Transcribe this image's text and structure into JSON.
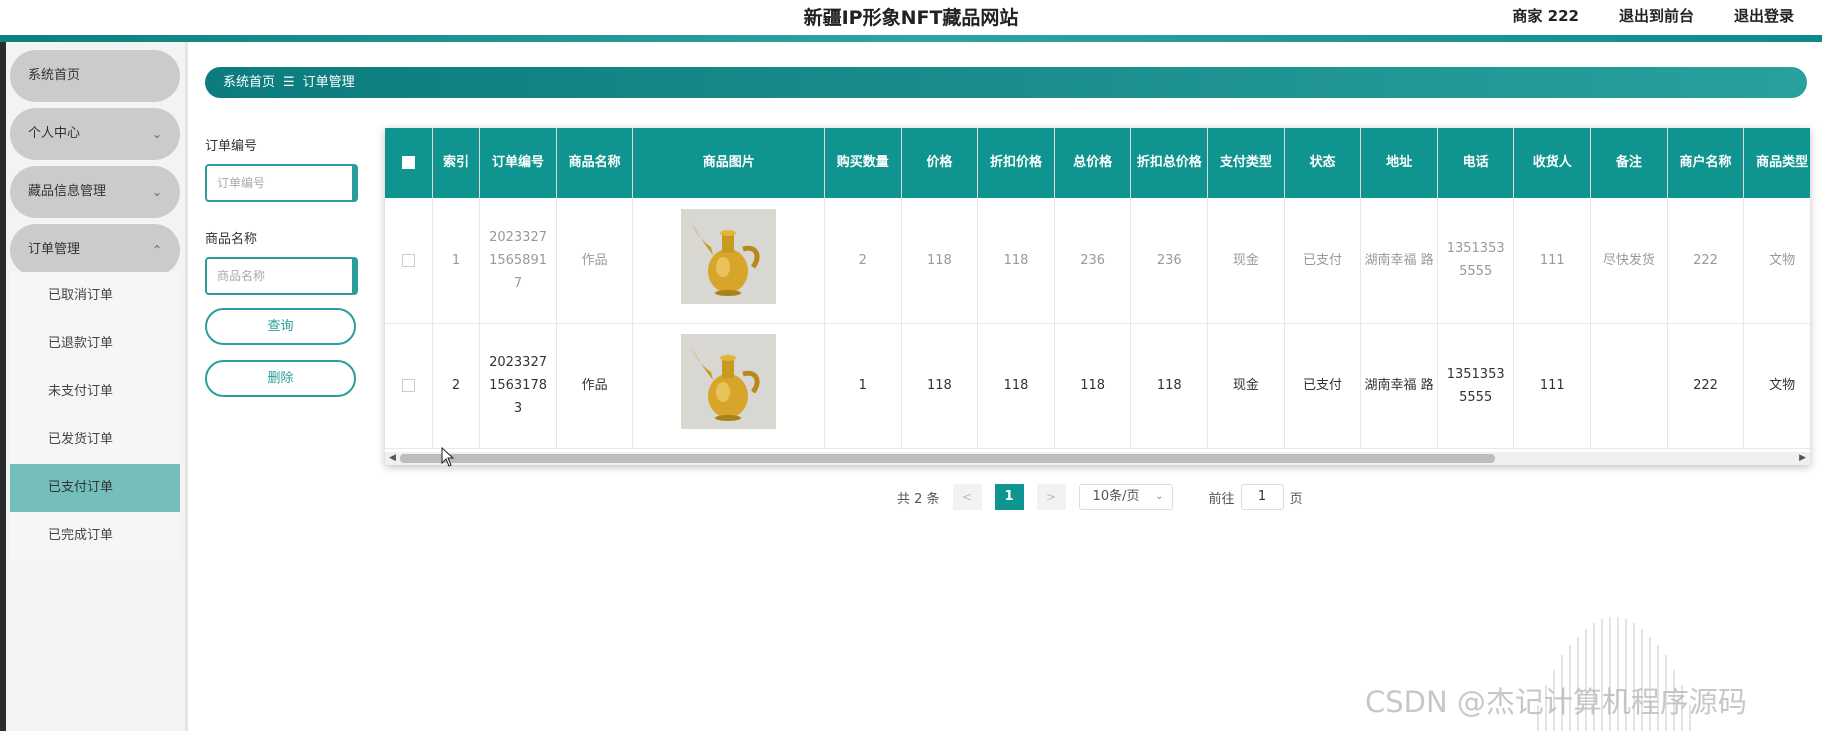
{
  "header": {
    "title": "新疆IP形象NFT藏品网站",
    "user_label": "商家 222",
    "back_to_front": "退出到前台",
    "logout": "退出登录"
  },
  "sidebar": {
    "items": [
      {
        "label": "系统首页"
      },
      {
        "label": "个人中心"
      },
      {
        "label": "藏品信息管理"
      },
      {
        "label": "订单管理"
      }
    ],
    "submenu": [
      {
        "label": "已取消订单"
      },
      {
        "label": "已退款订单"
      },
      {
        "label": "未支付订单"
      },
      {
        "label": "已发货订单"
      },
      {
        "label": "已支付订单"
      },
      {
        "label": "已完成订单"
      }
    ]
  },
  "breadcrumb": {
    "home": "系统首页",
    "separator": "☰",
    "current": "订单管理"
  },
  "search": {
    "order_no_label": "订单编号",
    "order_no_placeholder": "订单编号",
    "product_label": "商品名称",
    "product_placeholder": "商品名称",
    "query_button": "查询",
    "delete_button": "删除"
  },
  "table": {
    "headers": [
      "索引",
      "订单编号",
      "商品名称",
      "商品图片",
      "购买数量",
      "价格",
      "折扣价格",
      "总价格",
      "折扣总价格",
      "支付类型",
      "状态",
      "地址",
      "电话",
      "收货人",
      "备注",
      "商户名称",
      "商品类型"
    ],
    "rows": [
      {
        "index": "1",
        "order_no": "2023327 1565891 7",
        "product": "作品",
        "image": "golden-teapot-image",
        "qty": "2",
        "price": "118",
        "discount_price": "118",
        "total": "236",
        "discount_total": "236",
        "pay_type": "现金",
        "status": "已支付",
        "address": "湖南幸福 路",
        "phone": "1351353 5555",
        "receiver": "111",
        "remark": "尽快发货",
        "merchant": "222",
        "category": "文物"
      },
      {
        "index": "2",
        "order_no": "2023327 1563178 3",
        "product": "作品",
        "image": "golden-teapot-image",
        "qty": "1",
        "price": "118",
        "discount_price": "118",
        "total": "118",
        "discount_total": "118",
        "pay_type": "现金",
        "status": "已支付",
        "address": "湖南幸福 路",
        "phone": "1351353 5555",
        "receiver": "111",
        "remark": "",
        "merchant": "222",
        "category": "文物"
      }
    ]
  },
  "pagination": {
    "total": "共 2 条",
    "prev": "<",
    "page": "1",
    "next": ">",
    "page_size": "10条/页",
    "goto_label": "前往",
    "goto_value": "1",
    "goto_suffix": "页"
  },
  "watermark": "CSDN @杰记计算机程序源码",
  "colors": {
    "accent": "#0f948f",
    "active_menu": "#74bfbb",
    "menu_pill": "#cbcbcb"
  }
}
